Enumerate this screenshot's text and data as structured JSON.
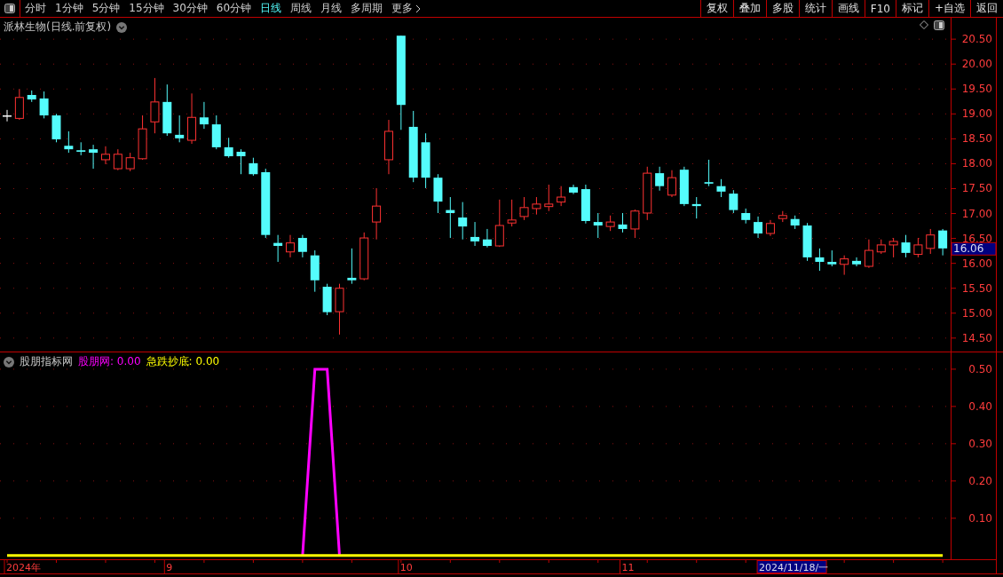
{
  "toolbar": {
    "tabs": [
      {
        "label": "分时",
        "selected": false
      },
      {
        "label": "1分钟",
        "selected": false
      },
      {
        "label": "5分钟",
        "selected": false
      },
      {
        "label": "15分钟",
        "selected": false
      },
      {
        "label": "30分钟",
        "selected": false
      },
      {
        "label": "60分钟",
        "selected": false
      },
      {
        "label": "日线",
        "selected": true
      },
      {
        "label": "周线",
        "selected": false
      },
      {
        "label": "月线",
        "selected": false
      },
      {
        "label": "多周期",
        "selected": false
      },
      {
        "label": "更多",
        "selected": false
      }
    ],
    "buttons": [
      "复权",
      "叠加",
      "多股",
      "统计",
      "画线",
      "F10",
      "标记",
      "+自选",
      "返回"
    ]
  },
  "main_chart": {
    "title": "派林生物(日线.前复权)",
    "current_price": "16.06",
    "chart_data": {
      "type": "candlestick",
      "grid": true,
      "ylim": [
        14.23,
        20.93
      ],
      "yticks": [
        {
          "value": 20.5,
          "label": "20.50"
        },
        {
          "value": 20,
          "label": "20.00"
        },
        {
          "value": 19.5,
          "label": "19.50"
        },
        {
          "value": 19,
          "label": "19.00"
        },
        {
          "value": 18.5,
          "label": "18.50"
        },
        {
          "value": 18,
          "label": "18.00"
        },
        {
          "value": 17.5,
          "label": "17.50"
        },
        {
          "value": 17,
          "label": "17.00"
        },
        {
          "value": 16.5,
          "label": "16.50"
        },
        {
          "value": 16,
          "label": "16.00"
        },
        {
          "value": 15.5,
          "label": "15.50"
        },
        {
          "value": 15,
          "label": "15.00"
        },
        {
          "value": 14.5,
          "label": "14.50"
        }
      ],
      "ohlc": [
        [
          18.97,
          19.08,
          18.85,
          18.97
        ],
        [
          18.91,
          19.5,
          18.88,
          19.33
        ],
        [
          19.38,
          19.47,
          19.24,
          19.29
        ],
        [
          19.31,
          19.45,
          18.91,
          18.97
        ],
        [
          18.97,
          19.0,
          18.43,
          18.49
        ],
        [
          18.36,
          18.65,
          18.22,
          18.29
        ],
        [
          18.27,
          18.43,
          18.17,
          18.24
        ],
        [
          18.29,
          18.38,
          17.9,
          18.22
        ],
        [
          18.08,
          18.35,
          17.99,
          18.19
        ],
        [
          17.9,
          18.29,
          17.87,
          18.19
        ],
        [
          17.9,
          18.22,
          17.85,
          18.12
        ],
        [
          18.1,
          18.97,
          18.08,
          18.7
        ],
        [
          18.84,
          19.72,
          18.61,
          19.24
        ],
        [
          19.24,
          19.59,
          18.56,
          18.61
        ],
        [
          18.58,
          18.97,
          18.43,
          18.51
        ],
        [
          18.47,
          19.41,
          18.4,
          18.93
        ],
        [
          18.93,
          19.24,
          18.7,
          18.79
        ],
        [
          18.79,
          18.97,
          18.29,
          18.33
        ],
        [
          18.33,
          18.52,
          18.12,
          18.15
        ],
        [
          18.24,
          18.29,
          17.79,
          18.15
        ],
        [
          18.01,
          18.12,
          17.76,
          17.79
        ],
        [
          17.83,
          17.9,
          16.51,
          16.57
        ],
        [
          16.41,
          16.57,
          16.03,
          16.35
        ],
        [
          16.23,
          16.57,
          16.12,
          16.41
        ],
        [
          16.51,
          16.57,
          16.12,
          16.23
        ],
        [
          16.16,
          16.26,
          15.43,
          15.66
        ],
        [
          15.53,
          15.59,
          14.96,
          15.02
        ],
        [
          15.03,
          15.59,
          14.57,
          15.5
        ],
        [
          15.71,
          16.3,
          15.59,
          15.66
        ],
        [
          15.69,
          16.62,
          15.66,
          16.51
        ],
        [
          16.83,
          17.51,
          16.48,
          17.15
        ],
        [
          18.08,
          18.88,
          17.79,
          18.65
        ],
        [
          20.57,
          20.57,
          18.68,
          19.18
        ],
        [
          18.74,
          19.06,
          17.63,
          17.72
        ],
        [
          18.43,
          18.61,
          17.51,
          17.72
        ],
        [
          17.72,
          17.79,
          17.01,
          17.24
        ],
        [
          17.07,
          17.33,
          16.51,
          17.01
        ],
        [
          16.92,
          17.23,
          16.48,
          16.74
        ],
        [
          16.53,
          16.83,
          16.35,
          16.44
        ],
        [
          16.48,
          16.69,
          16.32,
          16.35
        ],
        [
          16.35,
          17.28,
          16.33,
          16.76
        ],
        [
          16.81,
          17.28,
          16.74,
          16.87
        ],
        [
          16.94,
          17.33,
          16.87,
          17.12
        ],
        [
          17.1,
          17.33,
          16.98,
          17.19
        ],
        [
          17.14,
          17.58,
          17.05,
          17.19
        ],
        [
          17.23,
          17.55,
          17.15,
          17.33
        ],
        [
          17.53,
          17.58,
          17.39,
          17.42
        ],
        [
          17.49,
          17.58,
          16.8,
          16.85
        ],
        [
          16.83,
          17.01,
          16.51,
          16.76
        ],
        [
          16.74,
          16.96,
          16.65,
          16.83
        ],
        [
          16.78,
          17.01,
          16.62,
          16.69
        ],
        [
          16.69,
          17.08,
          16.51,
          17.05
        ],
        [
          17.01,
          17.94,
          16.87,
          17.81
        ],
        [
          17.81,
          17.94,
          17.46,
          17.55
        ],
        [
          17.37,
          17.87,
          17.33,
          17.72
        ],
        [
          17.88,
          17.94,
          17.15,
          17.19
        ],
        [
          17.19,
          17.33,
          16.9,
          17.15
        ],
        [
          17.63,
          18.08,
          17.55,
          17.6
        ],
        [
          17.55,
          17.69,
          17.33,
          17.44
        ],
        [
          17.4,
          17.47,
          17.01,
          17.07
        ],
        [
          17.01,
          17.1,
          16.8,
          16.87
        ],
        [
          16.83,
          16.94,
          16.51,
          16.6
        ],
        [
          16.6,
          16.87,
          16.55,
          16.8
        ],
        [
          16.9,
          17.05,
          16.83,
          16.96
        ],
        [
          16.89,
          16.96,
          16.69,
          16.76
        ],
        [
          16.76,
          16.81,
          16.05,
          16.12
        ],
        [
          16.12,
          16.3,
          15.85,
          16.03
        ],
        [
          16.03,
          16.26,
          15.94,
          15.98
        ],
        [
          15.98,
          16.16,
          15.77,
          16.09
        ],
        [
          16.05,
          16.12,
          15.94,
          15.98
        ],
        [
          15.94,
          16.48,
          15.91,
          16.26
        ],
        [
          16.23,
          16.48,
          16.19,
          16.37
        ],
        [
          16.37,
          16.51,
          16.12,
          16.44
        ],
        [
          16.42,
          16.57,
          16.12,
          16.21
        ],
        [
          16.18,
          16.51,
          16.12,
          16.37
        ],
        [
          16.3,
          16.69,
          16.19,
          16.57
        ],
        [
          16.66,
          16.69,
          16.16,
          16.3
        ]
      ]
    }
  },
  "indicator": {
    "name": "股朋指标网",
    "readouts": [
      {
        "label": "股朋网: 0.00",
        "color": "#ff00ff"
      },
      {
        "label": "急跌抄底: 0.00",
        "color": "#ffff00"
      }
    ],
    "chart_data": {
      "type": "line",
      "grid": true,
      "ylim": [
        -0.01,
        0.545
      ],
      "yticks": [
        {
          "value": 0.5,
          "label": "0.50"
        },
        {
          "value": 0.4,
          "label": "0.40"
        },
        {
          "value": 0.3,
          "label": "0.30"
        },
        {
          "value": 0.2,
          "label": "0.20"
        },
        {
          "value": 0.1,
          "label": "0.10"
        }
      ],
      "series": [
        {
          "color": "#ff00ff",
          "values": [
            null,
            null,
            null,
            null,
            null,
            null,
            null,
            null,
            null,
            null,
            null,
            null,
            null,
            null,
            null,
            null,
            null,
            null,
            null,
            null,
            null,
            null,
            null,
            null,
            0,
            0.5,
            0.5,
            0,
            null,
            null,
            null,
            null,
            null,
            null,
            null,
            null,
            null,
            null,
            null,
            null,
            null,
            null,
            null,
            null,
            null,
            null,
            null,
            null,
            null,
            null,
            null,
            null,
            null,
            null,
            null,
            null,
            null,
            null,
            null,
            null,
            null,
            null,
            null,
            null,
            null,
            null,
            null,
            null,
            null,
            null,
            null,
            null,
            null,
            null,
            null,
            null,
            null
          ]
        },
        {
          "color": "#ffff00",
          "values": [
            0,
            0,
            0,
            0,
            0,
            0,
            0,
            0,
            0,
            0,
            0,
            0,
            0,
            0,
            0,
            0,
            0,
            0,
            0,
            0,
            0,
            0,
            0,
            0,
            0,
            0,
            0,
            0,
            0,
            0,
            0,
            0,
            0,
            0,
            0,
            0,
            0,
            0,
            0,
            0,
            0,
            0,
            0,
            0,
            0,
            0,
            0,
            0,
            0,
            0,
            0,
            0,
            0,
            0,
            0,
            0,
            0,
            0,
            0,
            0,
            0,
            0,
            0,
            0,
            0,
            0,
            0,
            0,
            0,
            0,
            0,
            0,
            0,
            0,
            0,
            0,
            0
          ]
        }
      ]
    }
  },
  "time_axis": {
    "labels": [
      "2024年",
      "9",
      "10",
      "11"
    ],
    "cursor_date": "2024/11/18/一"
  }
}
